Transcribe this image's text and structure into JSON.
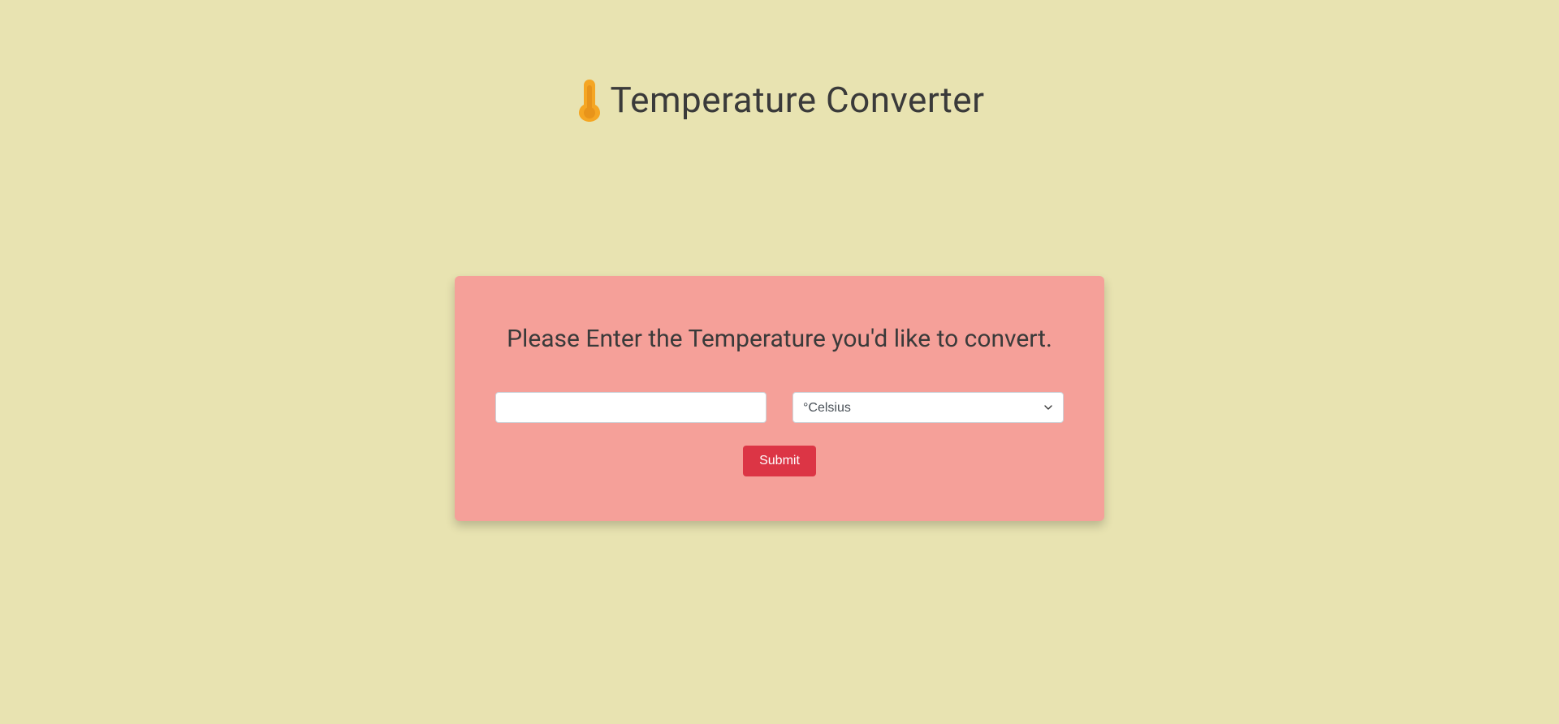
{
  "header": {
    "title": "Temperature Converter",
    "icon": "thermometer-icon"
  },
  "card": {
    "heading": "Please Enter the Temperature you'd like to convert.",
    "input": {
      "value": "",
      "placeholder": ""
    },
    "select": {
      "selected": "°Celsius",
      "options": [
        "°Celsius"
      ]
    },
    "submit_label": "Submit"
  },
  "colors": {
    "background": "#e8e3b1",
    "card_background": "#f5a099",
    "button_background": "#dc3545",
    "icon_color": "#f5a623",
    "text_color": "#3a3a3a"
  }
}
